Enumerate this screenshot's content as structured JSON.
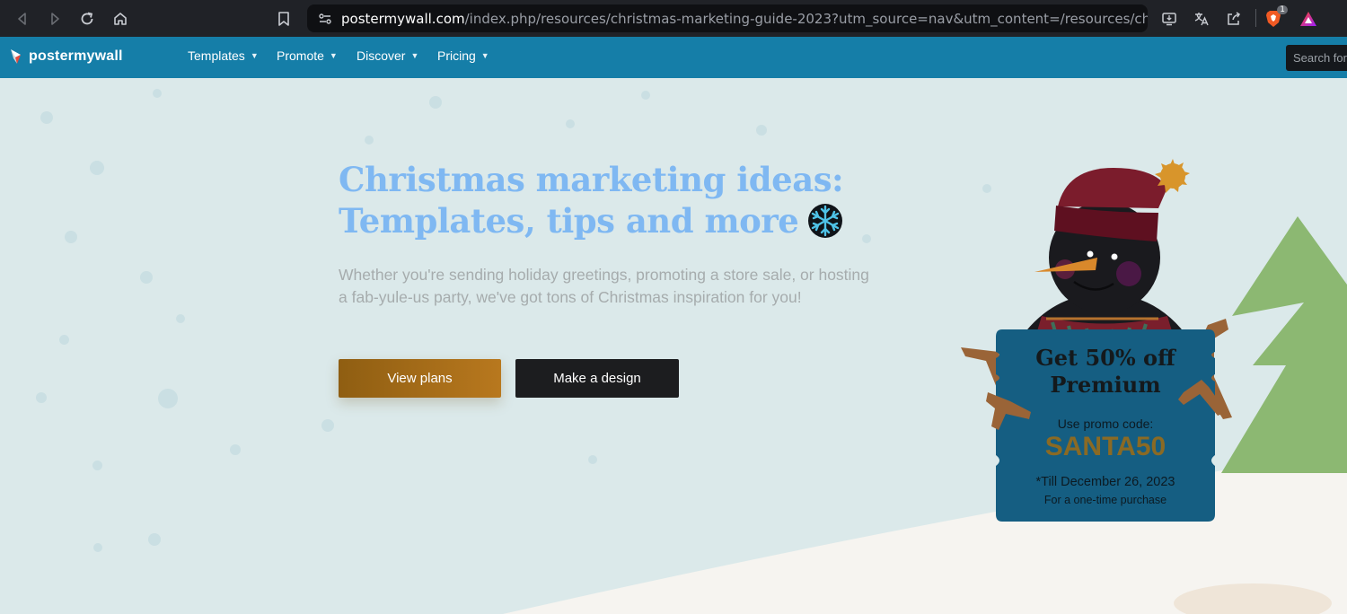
{
  "browser": {
    "url_host": "postermywall.com",
    "url_path": "/index.php/resources/christmas-marketing-guide-2023?utm_source=nav&utm_content=/resources/christma...",
    "shield_badge": "1",
    "icons": [
      "back-icon",
      "forward-icon",
      "reload-icon",
      "home-icon",
      "bookmark-icon",
      "site-settings-icon",
      "install-icon",
      "translate-icon",
      "share-icon",
      "brave-shield-icon",
      "brave-rewards-icon"
    ]
  },
  "site": {
    "logo_text": "postermywall",
    "menu": [
      {
        "label": "Templates"
      },
      {
        "label": "Promote"
      },
      {
        "label": "Discover"
      },
      {
        "label": "Pricing"
      }
    ],
    "search_placeholder": "Search for i"
  },
  "hero": {
    "headline_line1": "Christmas marketing ideas:",
    "headline_line2": "Templates, tips and more",
    "subtext": "Whether you're sending holiday greetings, promoting a store sale, or hosting a fab-yule-us party, we've got tons of Christmas inspiration for you!",
    "primary_button": "View plans",
    "secondary_button": "Make a design"
  },
  "promo": {
    "title_line1": "Get 50% off",
    "title_line2": "Premium",
    "code_label": "Use promo code:",
    "code": "SANTA50",
    "until": "*Till December 26, 2023",
    "note": "For a one-time purchase"
  },
  "colors": {
    "nav_bg": "#157ea8",
    "hero_bg": "#dbe9ea",
    "headline": "#7fb8f2",
    "primary_button": "#a36b18",
    "dark_button": "#1c1d1f",
    "sign": "#155e82",
    "promo_code": "#8a6a24",
    "tree": "#8cb872"
  }
}
